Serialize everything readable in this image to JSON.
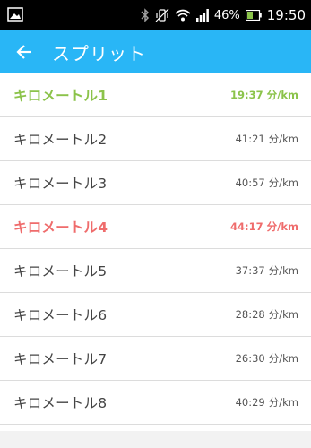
{
  "status_bar": {
    "battery_percent": "46%",
    "time": "19:50",
    "icons": [
      "image-icon",
      "bluetooth-icon",
      "vibrate-icon",
      "wifi-icon",
      "signal-icon",
      "battery-icon"
    ]
  },
  "toolbar": {
    "back_icon": "arrow-left-icon",
    "title": "スプリット",
    "color": "#29b6f6"
  },
  "splits": [
    {
      "label": "キロメートル1",
      "time": "19:37",
      "unit": "分/km",
      "status": "best"
    },
    {
      "label": "キロメートル2",
      "time": "41:21",
      "unit": "分/km",
      "status": "normal"
    },
    {
      "label": "キロメートル3",
      "time": "40:57",
      "unit": "分/km",
      "status": "normal"
    },
    {
      "label": "キロメートル4",
      "time": "44:17",
      "unit": "分/km",
      "status": "worst"
    },
    {
      "label": "キロメートル5",
      "time": "37:37",
      "unit": "分/km",
      "status": "normal"
    },
    {
      "label": "キロメートル6",
      "time": "28:28",
      "unit": "分/km",
      "status": "normal"
    },
    {
      "label": "キロメートル7",
      "time": "26:30",
      "unit": "分/km",
      "status": "normal"
    },
    {
      "label": "キロメートル8",
      "time": "40:29",
      "unit": "分/km",
      "status": "normal"
    }
  ],
  "colors": {
    "best": "#8bc34a",
    "worst": "#ef6c6c",
    "normal": "#444444"
  }
}
